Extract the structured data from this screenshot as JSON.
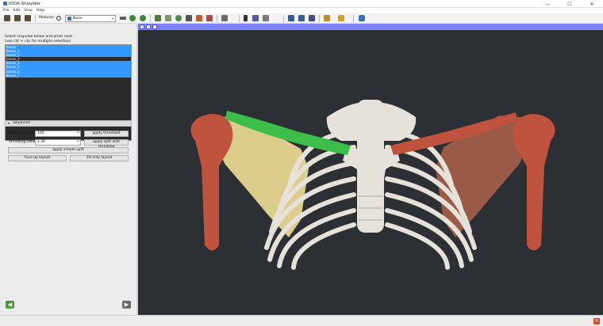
{
  "window": {
    "title": "IODA Shoulder",
    "minimize_glyph": "—",
    "maximize_glyph": "☐",
    "close_glyph": "✕"
  },
  "menu": [
    "File",
    "Edit",
    "View",
    "Help"
  ],
  "toolbar": {
    "modules_label": "Modules:",
    "module_selected": "None",
    "dropdown_glyph": "▾"
  },
  "panel": {
    "instruction_line1": "Select scapulae below and press next :",
    "instruction_line2": "(use ctrl + clic for multiple selection)",
    "segments": [
      {
        "label": "bones",
        "selected": true
      },
      {
        "label": "bones_1",
        "selected": true
      },
      {
        "label": "bones_2",
        "selected": true
      },
      {
        "label": "bones_3",
        "selected": false
      },
      {
        "label": "bones_4",
        "selected": true
      },
      {
        "label": "bones_5",
        "selected": true
      },
      {
        "label": "bones_6",
        "selected": true
      },
      {
        "label": "bones_7",
        "selected": true
      }
    ],
    "advanced_label": "advanced",
    "advanced_glyph": "▾",
    "threshold_label": "Threshold value:",
    "threshold_value": "100",
    "shrinking_label": "Shrinking value:",
    "shrinking_value": "1.30",
    "spin_glyph": "▴▾",
    "apply_threshold_label": "apply threshold",
    "apply_split_shrinking_label": "apply split with shrinking",
    "apply_simple_split_label": "apply simple split",
    "four_up_label": "Four-up layout",
    "threed_only_label": "3D only layout",
    "back_glyph": "◀",
    "next_glyph": "▶"
  },
  "status": {
    "close_glyph": "✕"
  },
  "colors": {
    "selection": "#3399ff",
    "viewport_background": "#2c2f33",
    "view_header": "#7e84ff",
    "bone": "#e6e2da",
    "clavicle_left": "#3bbf4a",
    "humerus": "#c0533d",
    "scapula_left": "#dccd8c",
    "scapula_right": "#9a5a48"
  },
  "icons": {
    "back": "arrow-left-icon",
    "next": "arrow-right-icon",
    "module_search": "search-icon",
    "python": "python-icon"
  }
}
